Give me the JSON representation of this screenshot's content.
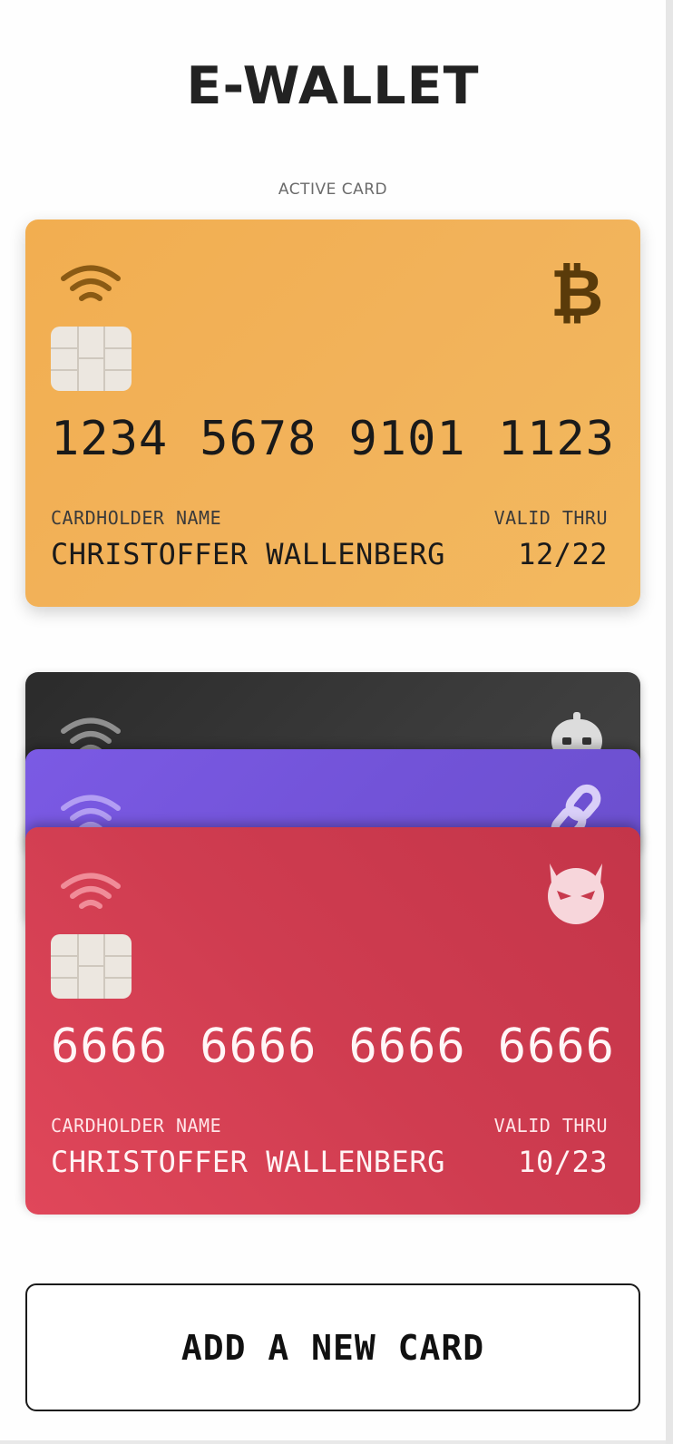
{
  "app": {
    "title": "E-WALLET"
  },
  "section_label": "ACTIVE CARD",
  "active_card": {
    "number_groups": [
      "1234",
      "5678",
      "9101",
      "1123"
    ],
    "holder_label": "CARDHOLDER NAME",
    "holder_name": "CHRISTOFFER WALLENBERG",
    "valid_label": "VALID THRU",
    "valid_thru": "12/22",
    "brand_icon": "bitcoin-icon",
    "color": "#f2b25a"
  },
  "stacked_cards": [
    {
      "brand_icon": "robot-icon",
      "color": "#333333"
    },
    {
      "brand_icon": "chain-link-icon",
      "color": "#7253d8"
    },
    {
      "brand_icon": "devil-icon",
      "color": "#cf3c50",
      "number_groups": [
        "6666",
        "6666",
        "6666",
        "6666"
      ],
      "holder_label": "CARDHOLDER NAME",
      "holder_name": "CHRISTOFFER WALLENBERG",
      "valid_label": "VALID THRU",
      "valid_thru": "10/23"
    }
  ],
  "add_button": {
    "label": "ADD A NEW CARD"
  }
}
